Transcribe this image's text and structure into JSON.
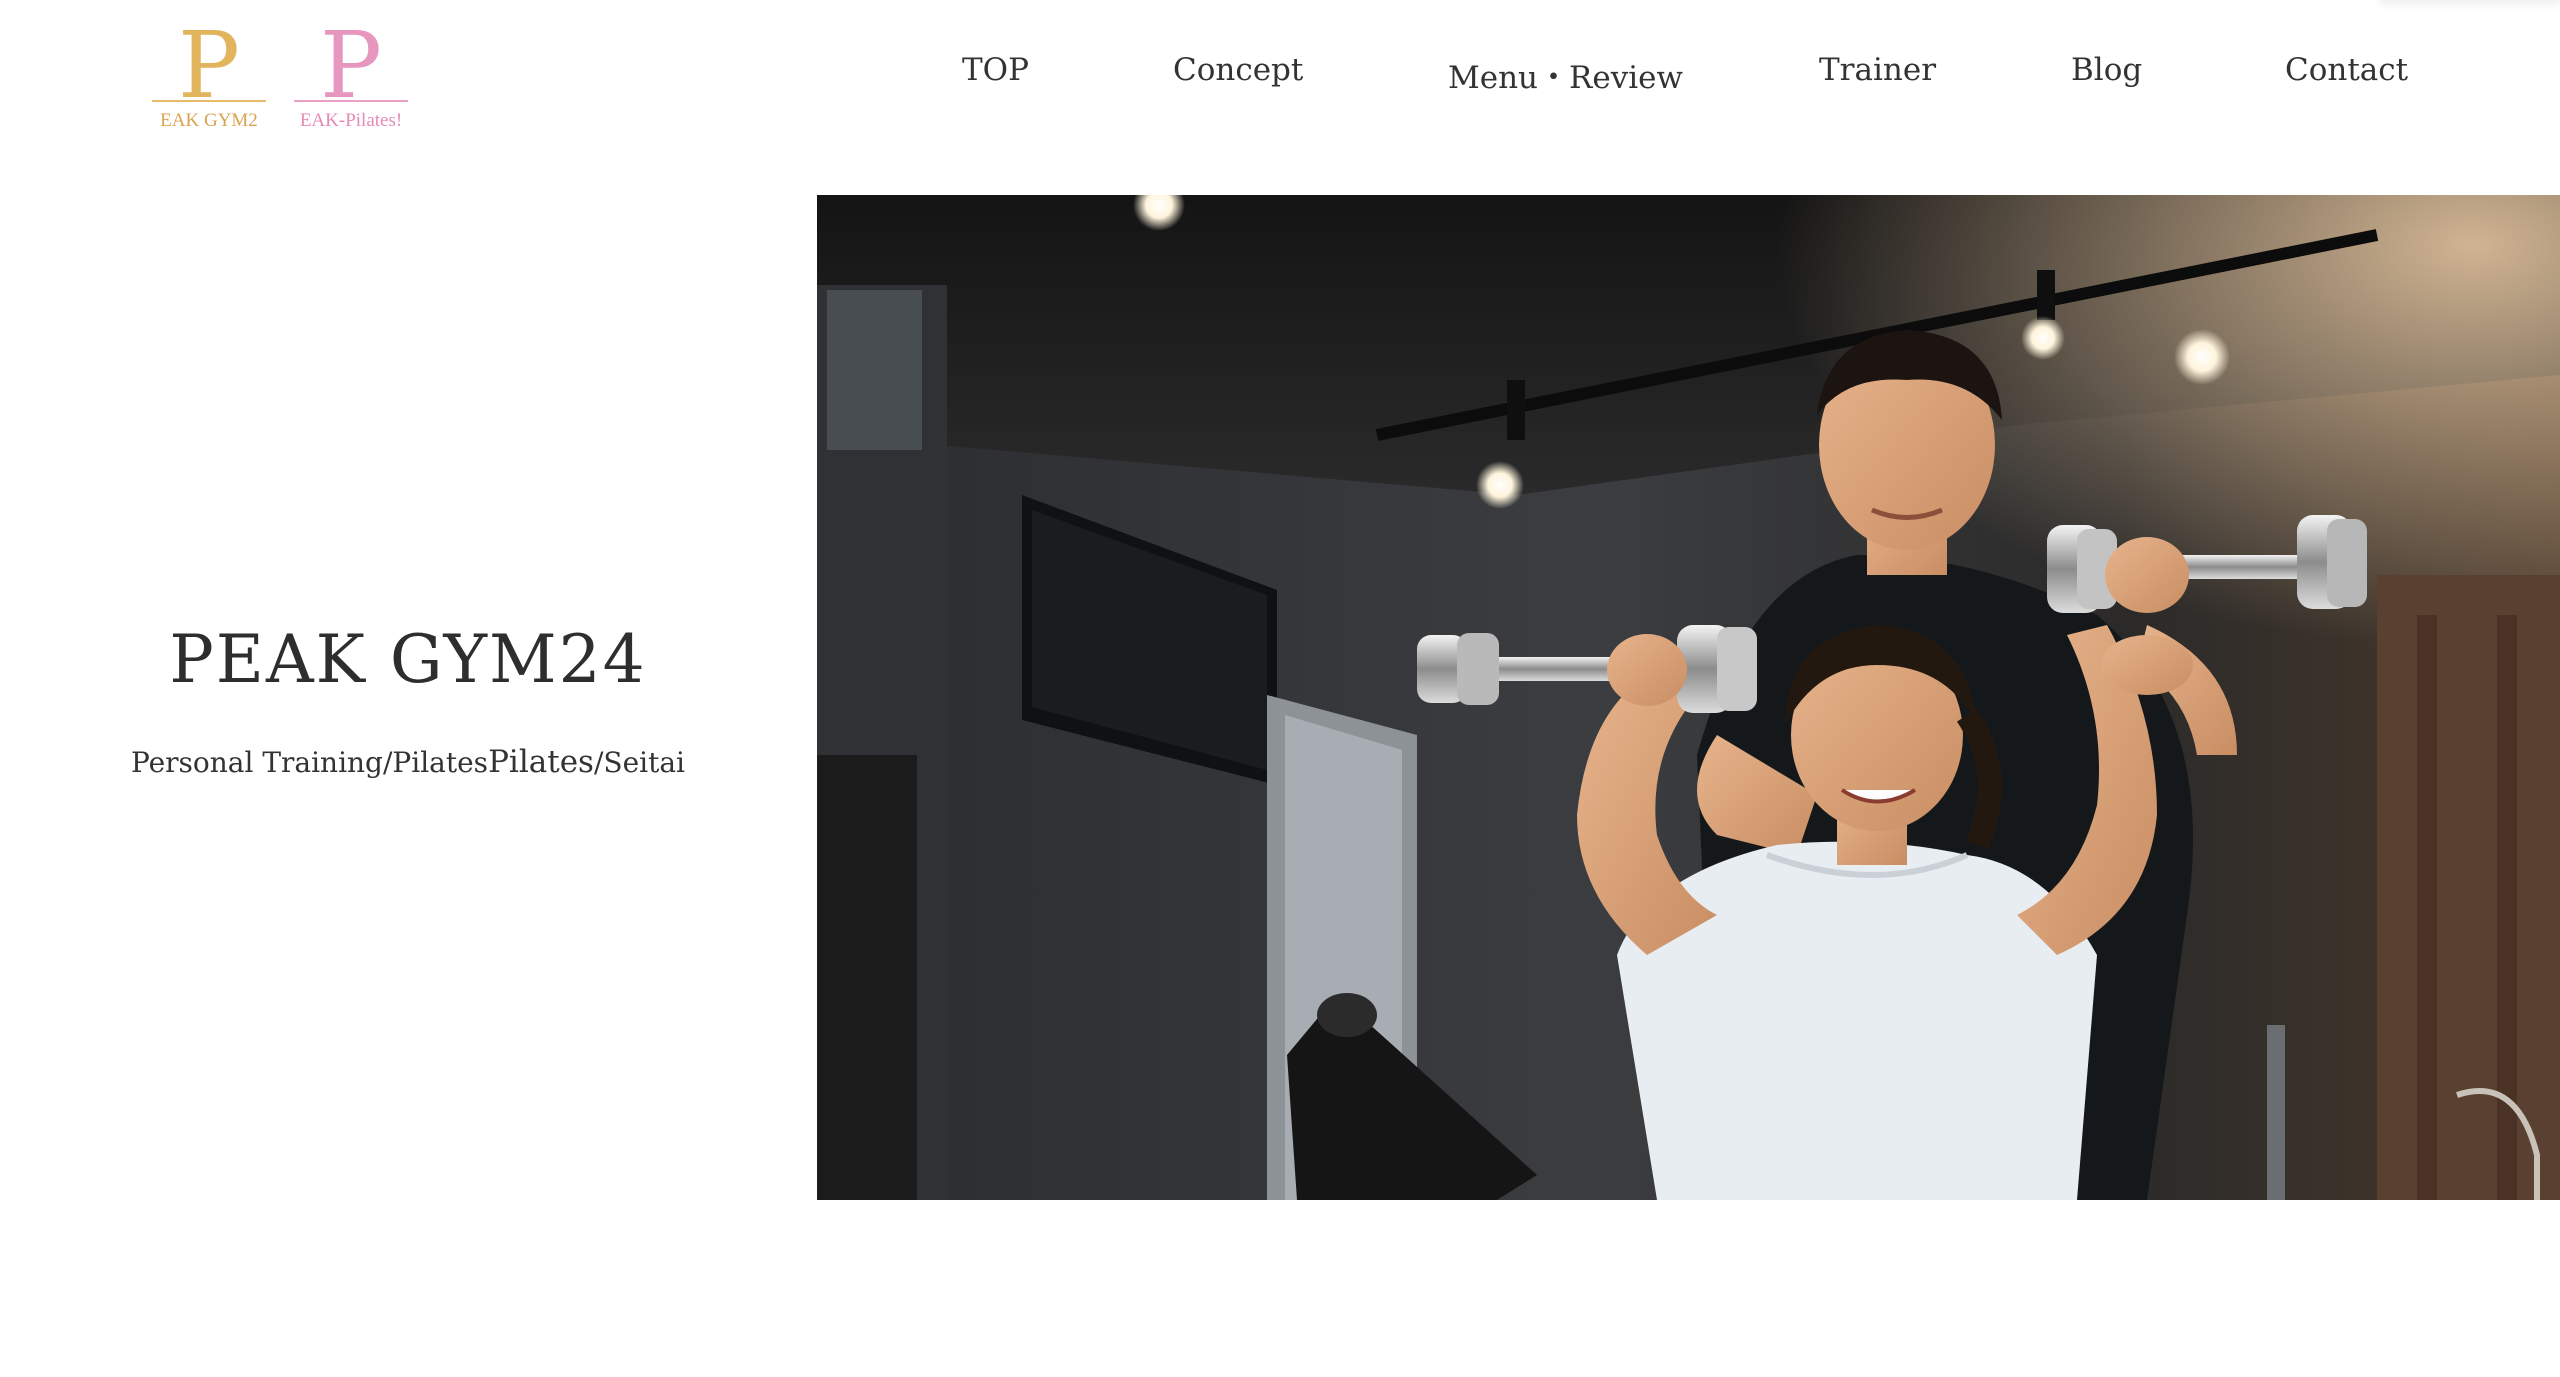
{
  "logos": {
    "gym": {
      "letter": "P",
      "subtitle": "EAK GYM2"
    },
    "pilates": {
      "letter": "P",
      "subtitle": "EAK-Pilates!"
    }
  },
  "nav": {
    "items": [
      {
        "label": "TOP"
      },
      {
        "label": "Concept"
      },
      {
        "label": "Menu・Review"
      },
      {
        "label": "Trainer"
      },
      {
        "label": "Blog"
      },
      {
        "label": "Contact"
      }
    ]
  },
  "hero": {
    "title": "PEAK GYM24",
    "subtitle_part1": "Personal Training/Pilates",
    "subtitle_part2": "Pilates",
    "subtitle_part3": "/Seitai"
  },
  "colors": {
    "gold": "#e2b45c",
    "pink": "#e796bd",
    "text": "#333333"
  }
}
